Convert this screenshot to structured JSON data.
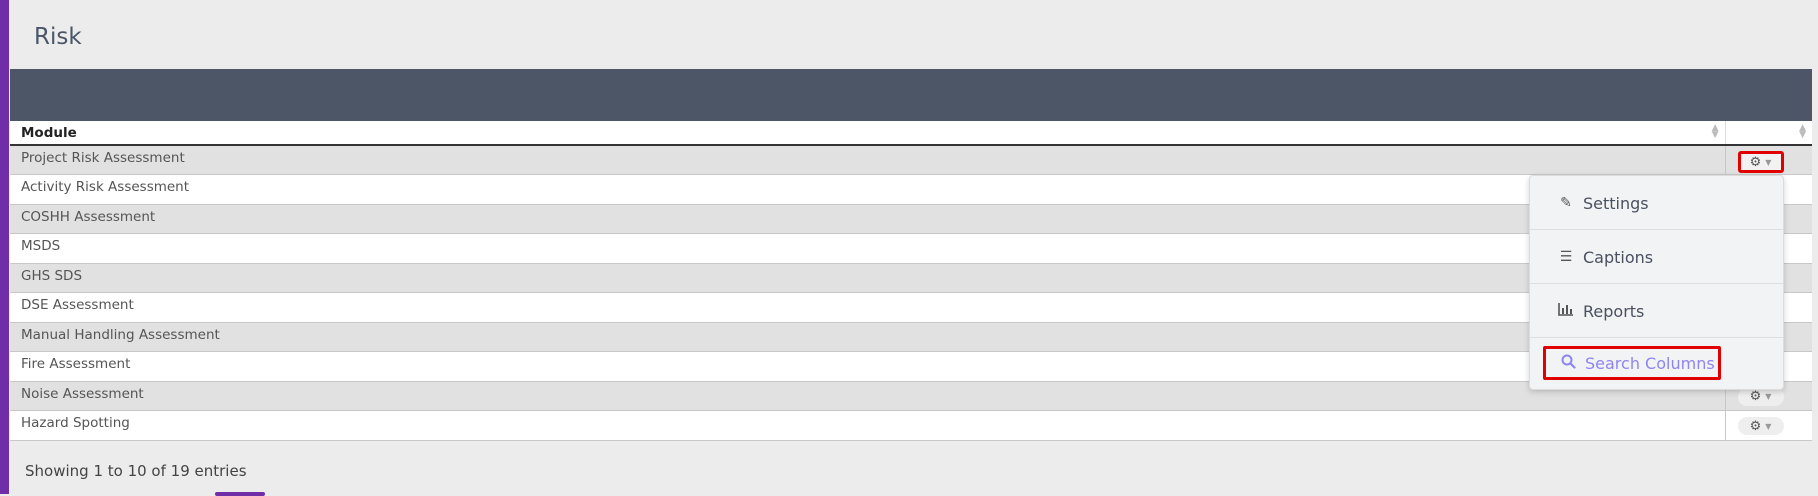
{
  "page": {
    "title": "Risk"
  },
  "table": {
    "columns": [
      {
        "label": "Module"
      },
      {
        "label": ""
      }
    ],
    "rows": [
      {
        "module": "Project Risk Assessment"
      },
      {
        "module": "Activity Risk Assessment"
      },
      {
        "module": "COSHH Assessment"
      },
      {
        "module": "MSDS"
      },
      {
        "module": "GHS SDS"
      },
      {
        "module": "DSE Assessment"
      },
      {
        "module": "Manual Handling Assessment"
      },
      {
        "module": "Fire Assessment"
      },
      {
        "module": "Noise Assessment"
      },
      {
        "module": "Hazard Spotting"
      }
    ]
  },
  "dropdown": {
    "items": [
      {
        "label": "Settings",
        "icon": "edit-icon"
      },
      {
        "label": "Captions",
        "icon": "list-icon"
      },
      {
        "label": "Reports",
        "icon": "bar-chart-icon"
      },
      {
        "label": "Search Columns",
        "icon": "search-icon"
      }
    ]
  },
  "footer": {
    "info": "Showing 1 to 10 of 19 entries"
  },
  "colors": {
    "accent": "#6f2da8",
    "header_band": "#4c5667",
    "highlight_border": "#e00000",
    "search_text": "#8e86f0"
  }
}
